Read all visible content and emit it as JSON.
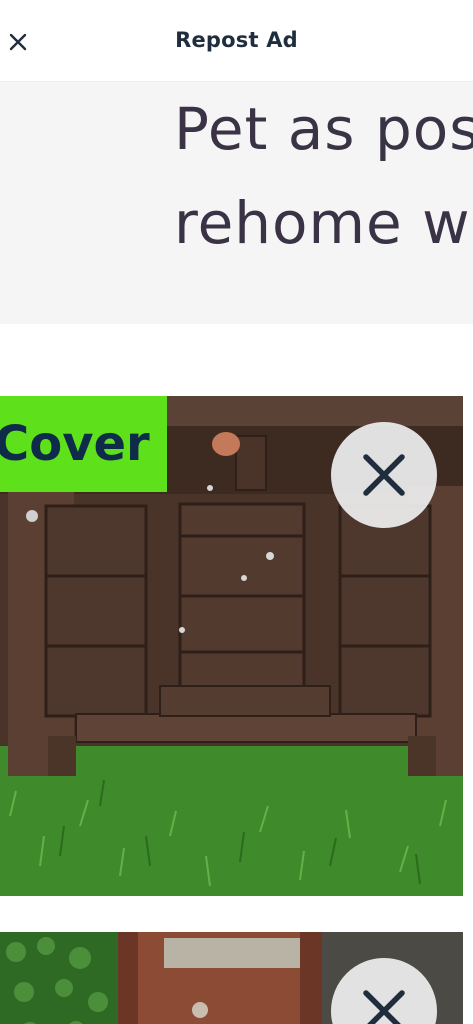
{
  "header": {
    "title": "Repost Ad",
    "close_icon": "close-icon"
  },
  "description": {
    "lines": [
      "Pet as pos",
      "rehome w"
    ]
  },
  "photos": [
    {
      "badge_label": "Cover",
      "remove_icon": "close-icon",
      "badge_color": "#5ee11a"
    },
    {
      "remove_icon": "close-icon"
    }
  ],
  "colors": {
    "title": "#1f2d3d",
    "badge_bg": "#5ee11a",
    "badge_text": "#0f2b4a",
    "panel_bg": "#f5f5f5"
  }
}
